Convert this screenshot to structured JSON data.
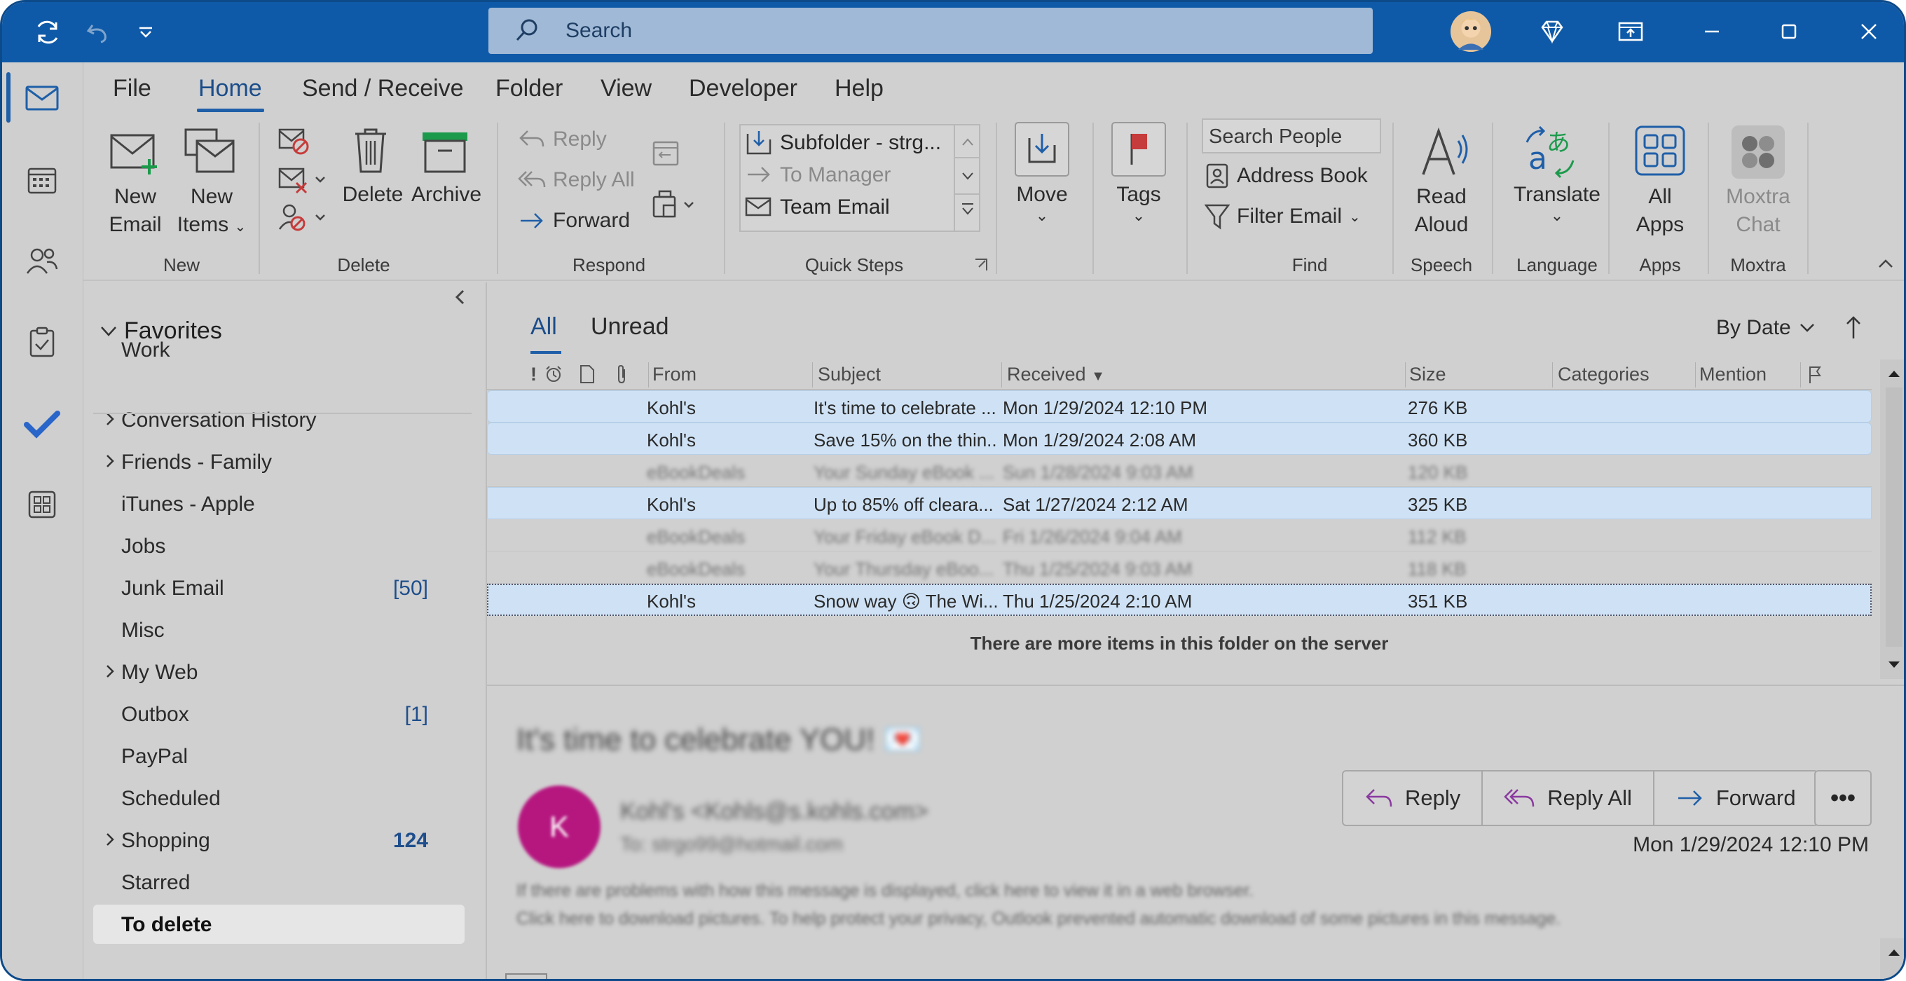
{
  "titlebar": {
    "search_placeholder": "Search"
  },
  "menu": {
    "tabs": [
      "File",
      "Home",
      "Send / Receive",
      "Folder",
      "View",
      "Developer",
      "Help"
    ],
    "active": "Home"
  },
  "ribbon": {
    "new_email": [
      "New",
      "Email"
    ],
    "new_items": [
      "New",
      "Items"
    ],
    "delete": "Delete",
    "archive": "Archive",
    "reply": "Reply",
    "reply_all": "Reply All",
    "forward": "Forward",
    "quick_steps": [
      "Subfolder - strg...",
      "To Manager",
      "Team Email"
    ],
    "move": "Move",
    "tags": "Tags",
    "search_people_placeholder": "Search People",
    "address_book": "Address Book",
    "filter_email": "Filter Email",
    "read_aloud": [
      "Read",
      "Aloud"
    ],
    "translate": "Translate",
    "all_apps": [
      "All",
      "Apps"
    ],
    "moxtra_chat": [
      "Moxtra",
      "Chat"
    ],
    "groups": [
      "New",
      "Delete",
      "Respond",
      "Quick Steps",
      "Find",
      "Speech",
      "Language",
      "Apps",
      "Moxtra"
    ]
  },
  "folders": {
    "favorites_label": "Favorites",
    "items": [
      {
        "name": "Work",
        "count": "",
        "expandable": false
      },
      {
        "name": "Conversation History",
        "count": "",
        "expandable": true
      },
      {
        "name": "Friends - Family",
        "count": "",
        "expandable": true
      },
      {
        "name": "iTunes - Apple",
        "count": "",
        "expandable": false
      },
      {
        "name": "Jobs",
        "count": "",
        "expandable": false
      },
      {
        "name": "Junk Email",
        "count": "[50]",
        "expandable": false
      },
      {
        "name": "Misc",
        "count": "",
        "expandable": false
      },
      {
        "name": "My Web",
        "count": "",
        "expandable": true
      },
      {
        "name": "Outbox",
        "count": "[1]",
        "expandable": false
      },
      {
        "name": "PayPal",
        "count": "",
        "expandable": false
      },
      {
        "name": "Scheduled",
        "count": "",
        "expandable": false
      },
      {
        "name": "Shopping",
        "count": "124",
        "expandable": true
      },
      {
        "name": "Starred",
        "count": "",
        "expandable": false
      },
      {
        "name": "To delete",
        "count": "",
        "expandable": false
      }
    ],
    "selected": "To delete"
  },
  "message_list": {
    "filter_tabs": [
      "All",
      "Unread"
    ],
    "sort": "By Date",
    "columns": {
      "from": "From",
      "subject": "Subject",
      "received": "Received",
      "size": "Size",
      "categories": "Categories",
      "mention": "Mention"
    },
    "rows": [
      {
        "from": "Kohl's",
        "subject": "It's time to celebrate ...",
        "received": "Mon 1/29/2024 12:10 PM",
        "size": "276 KB",
        "state": "selected"
      },
      {
        "from": "Kohl's",
        "subject": "Save 15% on the thin...",
        "received": "Mon 1/29/2024 2:08 AM",
        "size": "360 KB",
        "state": "selected"
      },
      {
        "from": "eBookDeals",
        "subject": "Your Sunday eBook ...",
        "received": "Sun 1/28/2024 9:03 AM",
        "size": "120 KB",
        "state": "blurred"
      },
      {
        "from": "Kohl's",
        "subject": "Up to 85% off cleara...",
        "received": "Sat 1/27/2024 2:12 AM",
        "size": "325 KB",
        "state": "selected"
      },
      {
        "from": "eBookDeals",
        "subject": "Your Friday eBook D...",
        "received": "Fri 1/26/2024 9:04 AM",
        "size": "112 KB",
        "state": "blurred"
      },
      {
        "from": "eBookDeals",
        "subject": "Your Thursday eBoo...",
        "received": "Thu 1/25/2024 9:03 AM",
        "size": "118 KB",
        "state": "blurred"
      },
      {
        "from": "Kohl's",
        "subject": "Snow way 🙃 The Wi...",
        "received": "Thu 1/25/2024 2:10 AM",
        "size": "351 KB",
        "state": "focused"
      }
    ],
    "more_items_text": "There are more items in this folder on the server"
  },
  "reading_pane": {
    "subject": "It's time to celebrate YOU! 💌",
    "avatar_letter": "K",
    "from": "Kohl's <Kohls@s.kohls.com>",
    "to": "To:  strgo99@hotmail.com",
    "info_line1": "If there are problems with how this message is displayed, click here to view it in a web browser.",
    "info_line2": "Click here to download pictures. To help protect your privacy, Outlook prevented automatic download of some pictures in this message.",
    "reply": "Reply",
    "reply_all": "Reply All",
    "forward": "Forward",
    "more": "•••",
    "date": "Mon 1/29/2024 12:10 PM"
  },
  "colors": {
    "titlebar": "#0f5aa8",
    "accent": "#1f5fa8",
    "selection": "#cfe2f5",
    "avatar": "#b5177f"
  }
}
